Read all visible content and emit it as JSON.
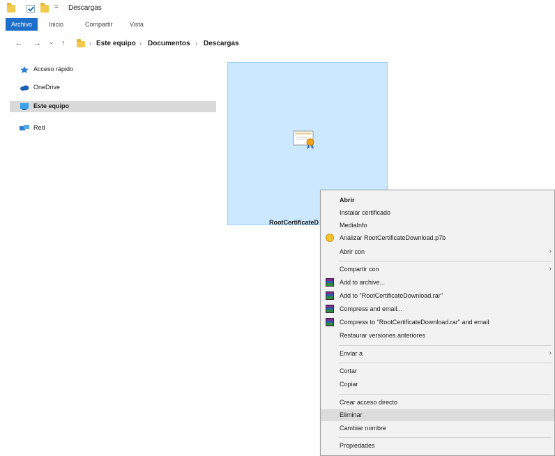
{
  "window": {
    "title": "Descargas",
    "quick_access_sep": "="
  },
  "ribbon": {
    "tabs": [
      "Archivo",
      "Inicio",
      "Compartir",
      "Vista"
    ]
  },
  "address": {
    "nav": {
      "back": "←",
      "forward": "→",
      "recent": "⌄",
      "up": "↑"
    },
    "separator": "›",
    "crumbs": [
      "Este equipo",
      "Documentos",
      "Descargas"
    ]
  },
  "nav_pane": {
    "items": [
      {
        "label": "Acceso rápido",
        "icon": "star-icon"
      },
      {
        "label": "OneDrive",
        "icon": "cloud-icon"
      },
      {
        "label": "Este equipo",
        "icon": "computer-icon"
      },
      {
        "label": "Red",
        "icon": "network-icon"
      }
    ]
  },
  "file": {
    "name": "RootCertificateD",
    "icon": "certificate-icon"
  },
  "context_menu": {
    "items": [
      {
        "label": "Abrir"
      },
      {
        "label": "Instalar certificado"
      },
      {
        "label": "MediaInfo"
      },
      {
        "label": "Analizar RootCertificateDownload.p7b",
        "icon": "antivirus-icon"
      },
      {
        "label": "Abrir con",
        "submenu": "›"
      },
      {
        "label": "Compartir con",
        "submenu": "›"
      },
      {
        "label": "Add to archive...",
        "icon": "winrar-icon"
      },
      {
        "label": "Add to \"RootCertificateDownload.rar\"",
        "icon": "winrar-icon"
      },
      {
        "label": "Compress and email...",
        "icon": "winrar-icon"
      },
      {
        "label": "Compress to \"RootCertificateDownload.rar\" and email",
        "icon": "winrar-icon"
      },
      {
        "label": "Restaurar versiones anteriores"
      },
      {
        "label": "Enviar a",
        "submenu": "›"
      },
      {
        "label": "Cortar"
      },
      {
        "label": "Copiar"
      },
      {
        "label": "Crear acceso directo"
      },
      {
        "label": "Eliminar",
        "highlighted": true
      },
      {
        "label": "Cambiar nombre"
      },
      {
        "label": "Propiedades"
      }
    ]
  },
  "colors": {
    "accent": "#1e6fc9",
    "selection_fill": "#cce8ff",
    "selection_border": "#99d1ff",
    "menu_bg": "#f2f2f2",
    "menu_highlight": "#dcdcdc",
    "nav_selected": "#d9d9d9"
  }
}
